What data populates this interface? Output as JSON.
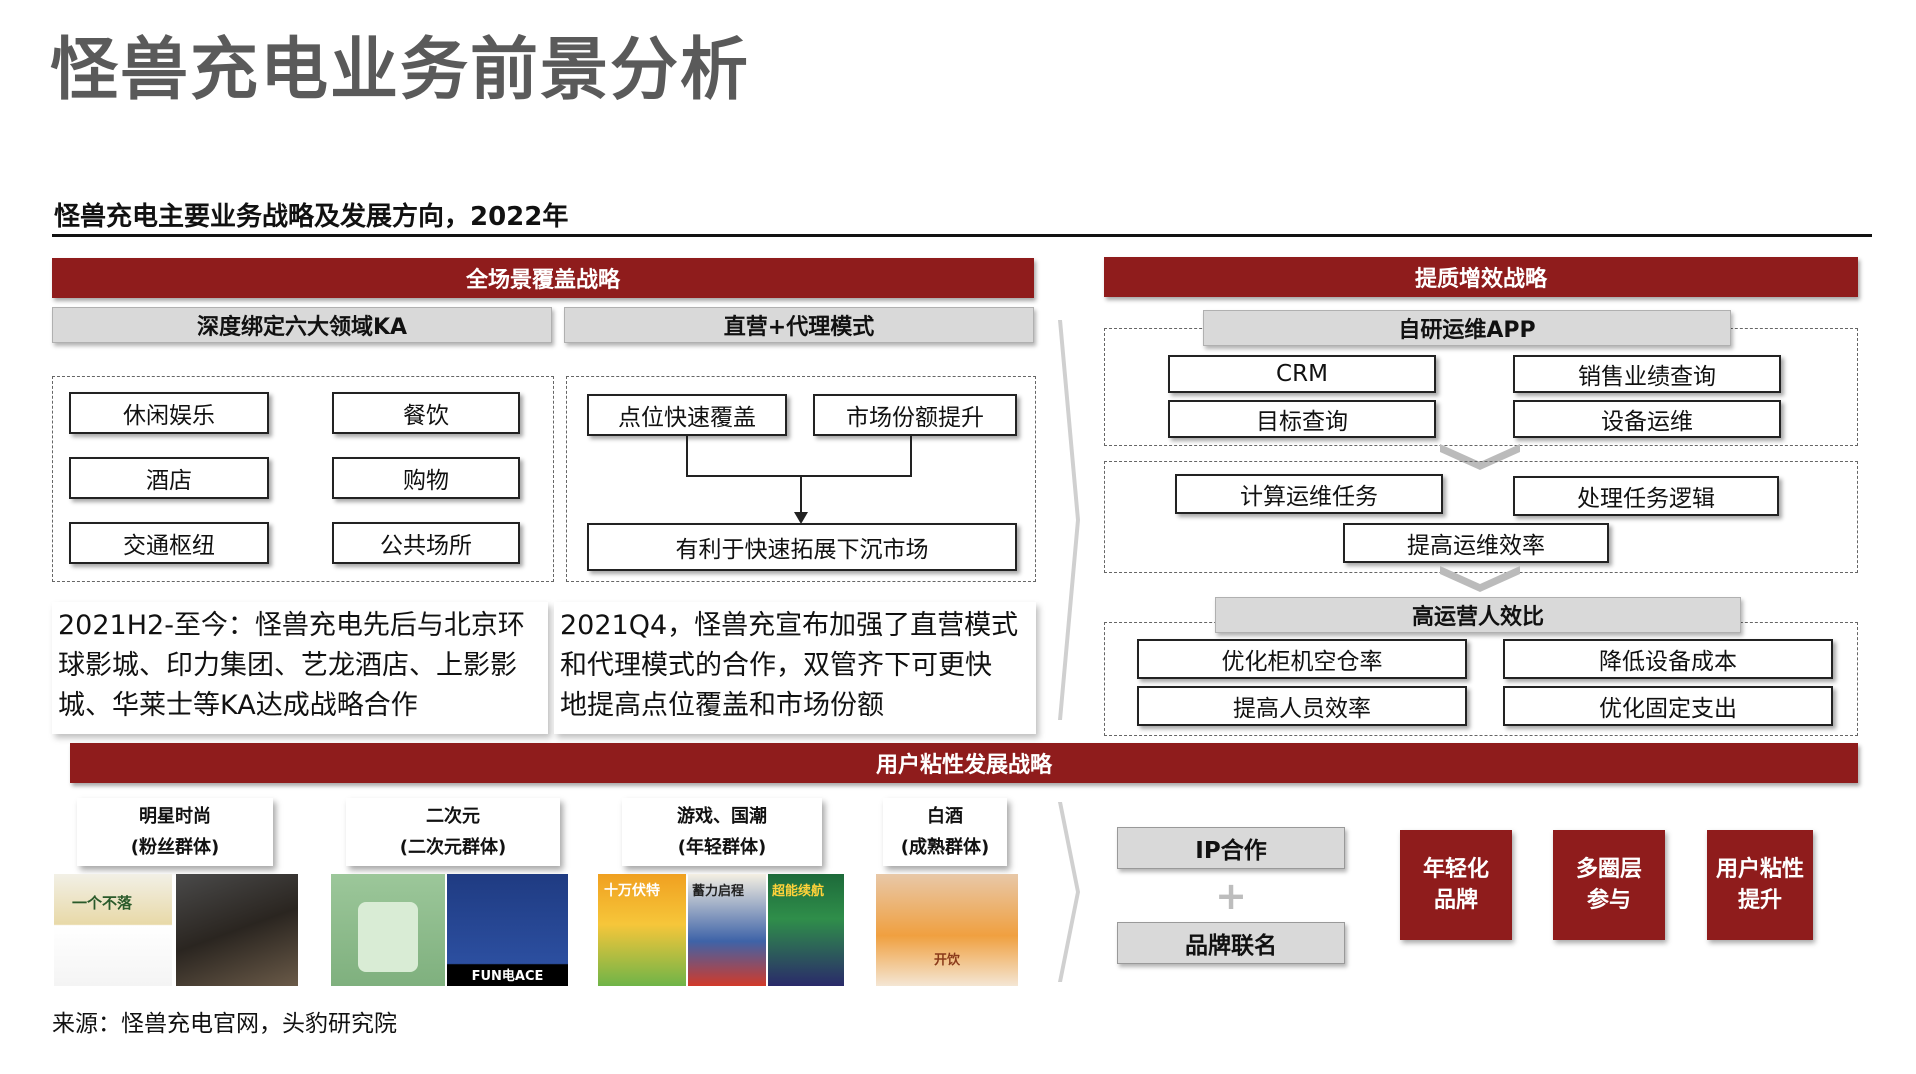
{
  "page": {
    "title": "怪兽充电业务前景分析",
    "subtitle": "怪兽充电主要业务战略及发展方向，2022年",
    "source": "来源：怪兽充电官网，头豹研究院"
  },
  "left_section": {
    "header": "全场景覆盖战略",
    "ka": {
      "label": "深度绑定六大领域KA",
      "items": [
        "休闲娱乐",
        "餐饮",
        "酒店",
        "购物",
        "交通枢纽",
        "公共场所"
      ],
      "note_lines": [
        "2021H2-至今：怪兽充电先后与北京环",
        "球影城、印力集团、艺龙酒店、上影影",
        "城、华莱士等KA达成战略合作"
      ]
    },
    "model": {
      "label": "直营+代理模式",
      "box1": "点位快速覆盖",
      "box2": "市场份额提升",
      "result": "有利于快速拓展下沉市场",
      "note_lines": [
        "2021Q4，怪兽充宣布加强了直营模式",
        "和代理模式的合作，双管齐下可更快",
        "地提高点位覆盖和市场份额"
      ]
    }
  },
  "right_section": {
    "header": "提质增效战略",
    "app": {
      "label": "自研运维APP",
      "items": [
        "CRM",
        "销售业绩查询",
        "目标查询",
        "设备运维"
      ]
    },
    "ops": {
      "items": [
        "计算运维任务",
        "处理任务逻辑"
      ],
      "result": "提高运维效率"
    },
    "efficiency": {
      "label": "高运营人效比",
      "items": [
        "优化柜机空仓率",
        "降低设备成本",
        "提高人员效率",
        "优化固定支出"
      ]
    }
  },
  "bottom_section": {
    "header": "用户粘性发展战略",
    "groups": [
      {
        "line1": "明星时尚",
        "line2": "(粉丝群体)"
      },
      {
        "line1": "二次元",
        "line2": "(二次元群体)"
      },
      {
        "line1": "游戏、国潮",
        "line2": "(年轻群体)"
      },
      {
        "line1": "白酒",
        "line2": "(成熟群体)"
      }
    ],
    "photo_captions": [
      "一个不落",
      "FUN电ACE",
      "十万伏特",
      "蓄力启程",
      "超能续航",
      "开饮"
    ],
    "ip": "IP合作",
    "plus": "+",
    "brand": "品牌联名",
    "outcomes": [
      {
        "line1": "年轻化",
        "line2": "品牌"
      },
      {
        "line1": "多圈层",
        "line2": "参与"
      },
      {
        "line1": "用户粘性",
        "line2": "提升"
      }
    ]
  },
  "colors": {
    "accent_red": "#8f1c1c",
    "gray_label": "#d9d9d9",
    "title_gray": "#5a5a5a"
  }
}
